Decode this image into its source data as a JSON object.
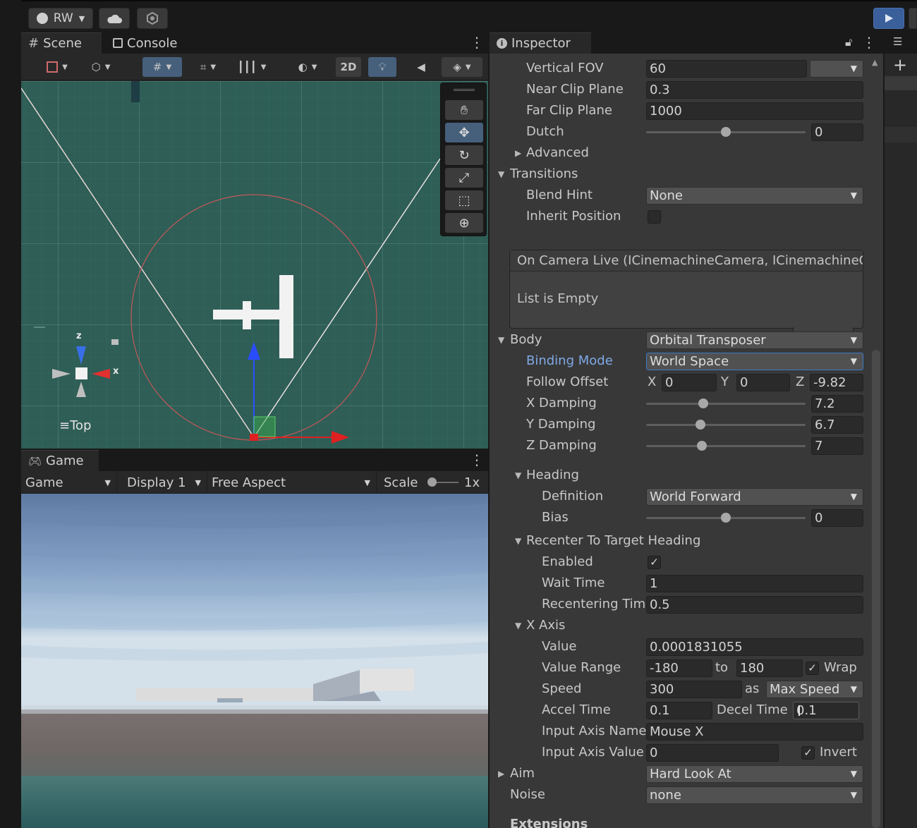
{
  "toolbar": {
    "account": "RW",
    "account_icon": "person-icon",
    "cloud_icon": "cloud-icon",
    "collab_icon": "collab-icon",
    "play_icon": "play-icon"
  },
  "scene": {
    "tab_scene": "Scene",
    "tab_console": "Console",
    "btn_2d": "2D",
    "view_label": "Top",
    "gizmo_x": "x",
    "gizmo_z": "z"
  },
  "game": {
    "tab_game": "Game",
    "dd_game": "Game",
    "dd_display": "Display 1",
    "dd_aspect": "Free Aspect",
    "scale_label": "Scale",
    "scale_value": "1x"
  },
  "inspector": {
    "tab": "Inspector",
    "rows": {
      "vertical_fov": {
        "label": "Vertical FOV",
        "value": "60"
      },
      "near_clip": {
        "label": "Near Clip Plane",
        "value": "0.3"
      },
      "far_clip": {
        "label": "Far Clip Plane",
        "value": "1000"
      },
      "dutch": {
        "label": "Dutch",
        "value": "0",
        "slider": 0.5
      },
      "advanced": {
        "label": "Advanced"
      },
      "transitions": {
        "label": "Transitions"
      },
      "blend_hint": {
        "label": "Blend Hint",
        "value": "None"
      },
      "inherit_position": {
        "label": "Inherit Position"
      },
      "body": {
        "label": "Body",
        "value": "Orbital Transposer"
      },
      "binding_mode": {
        "label": "Binding Mode",
        "value": "World Space"
      },
      "follow_offset": {
        "label": "Follow Offset",
        "x_label": "X",
        "x": "0",
        "y_label": "Y",
        "y": "0",
        "z_label": "Z",
        "z": "-9.82"
      },
      "x_damping": {
        "label": "X Damping",
        "value": "7.2",
        "slider": 0.36
      },
      "y_damping": {
        "label": "Y Damping",
        "value": "6.7",
        "slider": 0.34
      },
      "z_damping": {
        "label": "Z Damping",
        "value": "7",
        "slider": 0.35
      },
      "heading": {
        "label": "Heading"
      },
      "definition": {
        "label": "Definition",
        "value": "World Forward"
      },
      "bias": {
        "label": "Bias",
        "value": "0",
        "slider": 0.5
      },
      "recenter": {
        "label": "Recenter To Target Heading"
      },
      "enabled": {
        "label": "Enabled"
      },
      "wait_time": {
        "label": "Wait Time",
        "value": "1"
      },
      "recentering_time": {
        "label": "Recentering Tim",
        "value": "0.5"
      },
      "x_axis": {
        "label": "X Axis"
      },
      "axis_value": {
        "label": "Value",
        "value": "0.0001831055"
      },
      "value_range": {
        "label": "Value Range",
        "min": "-180",
        "to": "to",
        "max": "180",
        "wrap": "Wrap"
      },
      "speed": {
        "label": "Speed",
        "value": "300",
        "as": "as",
        "mode": "Max Speed"
      },
      "accel_time": {
        "label": "Accel Time",
        "value": "0.1",
        "decel_label": "Decel Time",
        "decel": "0.1"
      },
      "input_axis_name": {
        "label": "Input Axis Name",
        "value": "Mouse X"
      },
      "input_axis_value": {
        "label": "Input Axis Value",
        "value": "0",
        "invert": "Invert"
      },
      "aim": {
        "label": "Aim",
        "value": "Hard Look At"
      },
      "noise": {
        "label": "Noise",
        "value": "none"
      },
      "extensions": {
        "label": "Extensions"
      }
    },
    "event": {
      "header": "On Camera Live (ICinemachineCamera, ICinemachineC",
      "empty": "List is Empty",
      "plus": "+",
      "minus": "−"
    }
  },
  "colors": {
    "scene_bg": "#2e5e56",
    "accent_blue": "#3d7ac7",
    "play": "#3a5f9a"
  }
}
